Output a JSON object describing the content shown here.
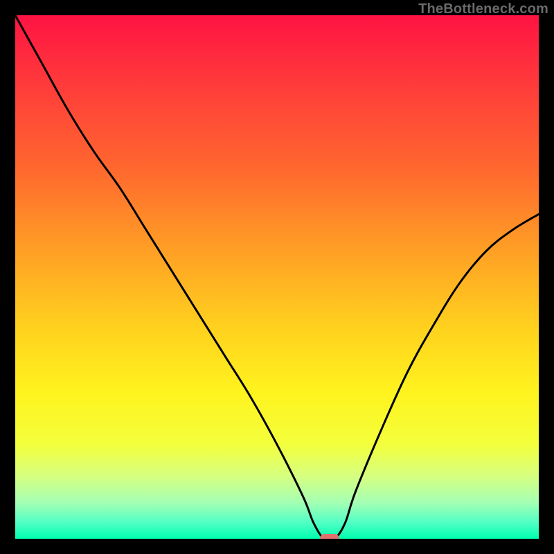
{
  "watermark": {
    "text": "TheBottleneck.com"
  },
  "colors": {
    "bg_black": "#000000",
    "curve": "#000000",
    "marker": "#e0726d"
  },
  "gradient_stops": [
    {
      "pct": 0,
      "color": "#ff1342"
    },
    {
      "pct": 14,
      "color": "#ff3d3a"
    },
    {
      "pct": 30,
      "color": "#ff6a2e"
    },
    {
      "pct": 46,
      "color": "#ffa324"
    },
    {
      "pct": 60,
      "color": "#ffd21e"
    },
    {
      "pct": 72,
      "color": "#fff31e"
    },
    {
      "pct": 82,
      "color": "#f3ff3c"
    },
    {
      "pct": 88,
      "color": "#d6ff80"
    },
    {
      "pct": 93,
      "color": "#a6ffb3"
    },
    {
      "pct": 97,
      "color": "#4effc5"
    },
    {
      "pct": 100,
      "color": "#00ffad"
    }
  ],
  "chart_data": {
    "type": "line",
    "title": "",
    "xlabel": "",
    "ylabel": "",
    "xlim": [
      0,
      100
    ],
    "ylim": [
      0,
      100
    ],
    "grid": false,
    "legend": false,
    "series": [
      {
        "name": "bottleneck-curve",
        "x": [
          0,
          5,
          10,
          15,
          20,
          25,
          30,
          35,
          40,
          45,
          50,
          55,
          57,
          59,
          61,
          63,
          65,
          70,
          75,
          80,
          85,
          90,
          95,
          100
        ],
        "y": [
          100,
          91,
          82,
          74,
          67,
          59,
          51,
          43,
          35,
          27,
          18,
          8,
          3,
          0,
          0,
          3,
          9,
          21,
          32,
          41,
          49,
          55,
          59,
          62
        ]
      }
    ],
    "annotations": [
      {
        "name": "optimal-marker",
        "x": 60,
        "y": 0
      }
    ]
  }
}
